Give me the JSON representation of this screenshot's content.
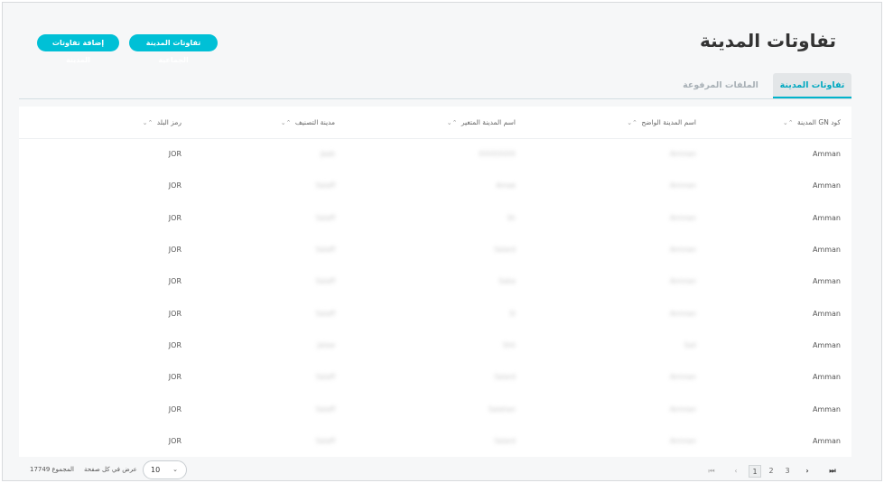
{
  "header": {
    "title": "تفاوتات المدينة",
    "bulk_button": "تفاوتات المدينة الجماعية",
    "add_button": "إضافة تفاوتات المدينة"
  },
  "tabs": [
    {
      "label": "تفاوتات المدينة",
      "active": true
    },
    {
      "label": "الملفات المرفوعة",
      "active": false
    }
  ],
  "table": {
    "columns": [
      "كود GN المدينة",
      "اسم المدينة الواضح",
      "اسم المدينة المتغير",
      "مدينة التصنيف",
      "رمز البلد"
    ],
    "rows": [
      [
        "Amman",
        "Amman",
        "XXXXXXXX",
        "Jaab",
        "JOR"
      ],
      [
        "Amman",
        "Amman",
        "Amae",
        "Salaff",
        "JOR"
      ],
      [
        "Amman",
        "Amman",
        "Sh",
        "Salaff",
        "JOR"
      ],
      [
        "Amman",
        "Amman",
        "Salard",
        "Salaff",
        "JOR"
      ],
      [
        "Amman",
        "Amman",
        "Saba",
        "Salaff",
        "JOR"
      ],
      [
        "Amman",
        "Amman",
        "Sl",
        "Salaff",
        "JOR"
      ],
      [
        "Amman",
        "Sail",
        "Shh",
        "Jalaw",
        "JOR"
      ],
      [
        "Amman",
        "Amman",
        "Salard",
        "Salaff",
        "JOR"
      ],
      [
        "Amman",
        "Amman",
        "Salahan",
        "Salaff",
        "JOR"
      ],
      [
        "Amman",
        "Amman",
        "Salard",
        "Salaff",
        "JOR"
      ]
    ]
  },
  "pagination": {
    "pages": [
      "1",
      "2",
      "3"
    ],
    "current_page": "1",
    "per_page_value": "10",
    "per_page_label": "عرض في كل صفحة",
    "total_label": "المجموع 17749"
  },
  "icons": {
    "sort": "sort-icon",
    "first": "first-page-icon",
    "prev": "prev-page-icon",
    "next": "next-page-icon",
    "last": "last-page-icon",
    "dropdown": "chevron-down-icon"
  },
  "colors": {
    "accent": "#00c0d6",
    "active_tab_text": "#00a8c0"
  }
}
